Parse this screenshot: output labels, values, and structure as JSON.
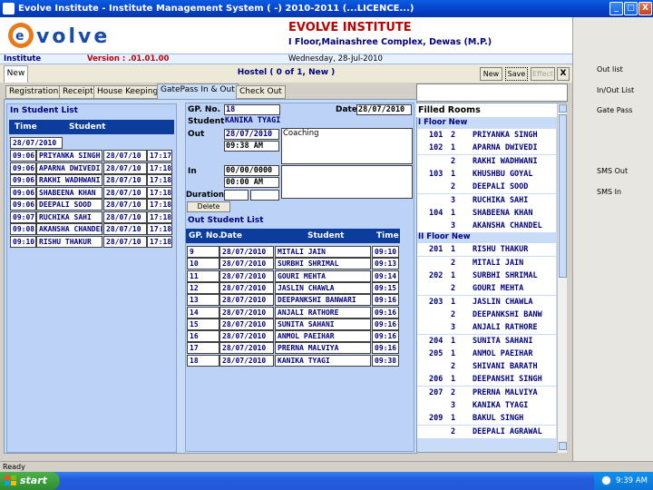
{
  "window": {
    "title": "Evolve Institute - Institute Management System ( -) 2010-2011 (...LICENCE...)",
    "minimize": "_",
    "maximize": "□",
    "close": "X"
  },
  "header": {
    "logo_text": "evolve",
    "institute_name": "EVOLVE INSTITUTE",
    "address": "I Floor,Mainashree Complex, Dewas (M.P.)"
  },
  "infobar": {
    "section": "Institute",
    "version": "Version : .01.01.00",
    "date": "Wednesday, 28-Jul-2010"
  },
  "toolbar": {
    "new_tab": "New",
    "record_title": "Hostel  ( 0 of 1, New )",
    "new": "New",
    "save": "Save",
    "effect": "Effect",
    "close": "X"
  },
  "tabs": [
    {
      "label": "Registration"
    },
    {
      "label": "Receipt"
    },
    {
      "label": "House Keeping"
    },
    {
      "label": "GatePass In & Out"
    },
    {
      "label": "Check Out"
    }
  ],
  "right_panel": {
    "items": [
      "Out list",
      "In/Out List",
      "Gate Pass",
      "SMS Out",
      "SMS In"
    ]
  },
  "in_list": {
    "title": "In Student List",
    "col_time": "Time",
    "col_student": "Student",
    "date": "28/07/2010",
    "rows": [
      {
        "time": "09:06",
        "student": "PRIYANKA SINGH",
        "date": "28/07/10",
        "time2": "17:17"
      },
      {
        "time": "09:06",
        "student": "APARNA DWIVEDI",
        "date": "28/07/10",
        "time2": "17:18"
      },
      {
        "time": "09:06",
        "student": "RAKHI WADHWANI",
        "date": "28/07/10",
        "time2": "17:18"
      },
      {
        "time": "09:06",
        "student": "SHABEENA KHAN",
        "date": "28/07/10",
        "time2": "17:18"
      },
      {
        "time": "09:06",
        "student": "DEEPALI SOOD",
        "date": "28/07/10",
        "time2": "17:18"
      },
      {
        "time": "09:07",
        "student": "RUCHIKA SAHI",
        "date": "28/07/10",
        "time2": "17:18"
      },
      {
        "time": "09:08",
        "student": "AKANSHA CHANDEL",
        "date": "28/07/10",
        "time2": "17:18"
      },
      {
        "time": "09:10",
        "student": "RISHU THAKUR",
        "date": "28/07/10",
        "time2": "17:18"
      }
    ]
  },
  "gatepass": {
    "gp_label": "GP. No.",
    "gp_no": "18",
    "date_label": "Date",
    "date": "28/07/2010",
    "student_label": "Student",
    "student": "KANIKA TYAGI",
    "out_label": "Out",
    "out_date": "28/07/2010",
    "out_time": "09:38 AM",
    "remark": "Coaching",
    "in_label": "In",
    "in_date": "00/00/0000",
    "in_time": "00:00 AM",
    "duration_label": "Duration",
    "delete": "Delete"
  },
  "out_list": {
    "title": "Out Student List",
    "col_gp": "GP. No.",
    "col_date": "Date",
    "col_student": "Student",
    "col_time": "Time",
    "rows": [
      {
        "gp": "9",
        "date": "28/07/2010",
        "student": "MITALI JAIN",
        "time": "09:10"
      },
      {
        "gp": "10",
        "date": "28/07/2010",
        "student": "SURBHI SHRIMAL",
        "time": "09:13"
      },
      {
        "gp": "11",
        "date": "28/07/2010",
        "student": "GOURI MEHTA",
        "time": "09:14"
      },
      {
        "gp": "12",
        "date": "28/07/2010",
        "student": "JASLIN CHAWLA",
        "time": "09:15"
      },
      {
        "gp": "13",
        "date": "28/07/2010",
        "student": "DEEPANKSHI BANWARI",
        "time": "09:16"
      },
      {
        "gp": "14",
        "date": "28/07/2010",
        "student": "ANJALI RATHORE",
        "time": "09:16"
      },
      {
        "gp": "15",
        "date": "28/07/2010",
        "student": "SUNITA SAHANI",
        "time": "09:16"
      },
      {
        "gp": "16",
        "date": "28/07/2010",
        "student": "ANMOL PAEIHAR",
        "time": "09:16"
      },
      {
        "gp": "17",
        "date": "28/07/2010",
        "student": "PRERNA MALVIYA",
        "time": "09:16"
      },
      {
        "gp": "18",
        "date": "28/07/2010",
        "student": "KANIKA TYAGI",
        "time": "09:38"
      }
    ]
  },
  "filled_rooms": {
    "title": "Filled Rooms",
    "floors": [
      {
        "name": "I Floor New",
        "rows": [
          {
            "room": "101",
            "bed": "2",
            "name": "PRIYANKA SINGH"
          },
          {
            "room": "102",
            "bed": "1",
            "name": "APARNA DWIVEDI"
          },
          {
            "room": "",
            "bed": "2",
            "name": "RAKHI WADHWANI"
          },
          {
            "room": "103",
            "bed": "1",
            "name": "KHUSHBU GOYAL"
          },
          {
            "room": "",
            "bed": "2",
            "name": "DEEPALI SOOD"
          },
          {
            "room": "",
            "bed": "3",
            "name": "RUCHIKA SAHI"
          },
          {
            "room": "104",
            "bed": "1",
            "name": "SHABEENA KHAN"
          },
          {
            "room": "",
            "bed": "3",
            "name": "AKANSHA CHANDEL"
          }
        ]
      },
      {
        "name": "II Floor New",
        "rows": [
          {
            "room": "201",
            "bed": "1",
            "name": "RISHU THAKUR"
          },
          {
            "room": "",
            "bed": "2",
            "name": "MITALI JAIN"
          },
          {
            "room": "202",
            "bed": "1",
            "name": "SURBHI SHRIMAL"
          },
          {
            "room": "",
            "bed": "2",
            "name": "GOURI MEHTA"
          },
          {
            "room": "203",
            "bed": "1",
            "name": "JASLIN CHAWLA"
          },
          {
            "room": "",
            "bed": "2",
            "name": "DEEPANKSHI BANW"
          },
          {
            "room": "",
            "bed": "3",
            "name": "ANJALI RATHORE"
          },
          {
            "room": "204",
            "bed": "1",
            "name": "SUNITA SAHANI"
          },
          {
            "room": "205",
            "bed": "1",
            "name": "ANMOL PAEIHAR"
          },
          {
            "room": "",
            "bed": "2",
            "name": "SHIVANI BARATH"
          },
          {
            "room": "206",
            "bed": "1",
            "name": "DEEPANSHI SINGH"
          },
          {
            "room": "207",
            "bed": "2",
            "name": "PRERNA MALVIYA"
          },
          {
            "room": "",
            "bed": "3",
            "name": "KANIKA TYAGI"
          },
          {
            "room": "209",
            "bed": "1",
            "name": "BAKUL SINGH"
          },
          {
            "room": "",
            "bed": "2",
            "name": "DEEPALI AGRAWAL"
          }
        ]
      }
    ]
  },
  "statusbar": {
    "text": "Ready"
  },
  "taskbar": {
    "start": "start",
    "clock": "9:39 AM"
  },
  "colors": {
    "accent": "#0c3c9c",
    "panel": "#c8dcf8",
    "brand_red": "#c00000",
    "navy": "#000080"
  }
}
